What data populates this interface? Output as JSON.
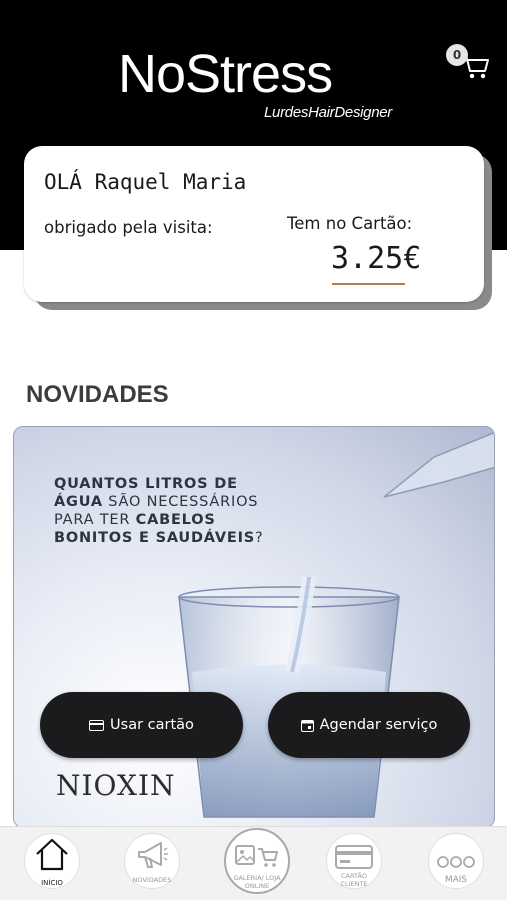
{
  "header": {
    "logo_main": "NoStress",
    "logo_sub": "LurdesHairDesigner",
    "cart_count": "0",
    "cart_icon": "shopping-cart-icon"
  },
  "card": {
    "greeting": "OLÁ Raquel Maria",
    "thanks": "obrigado pela visita:",
    "label": "Tem no Cartão:",
    "amount": "3.25€"
  },
  "news": {
    "title": "NOVIDADES",
    "promo_lines": [
      [
        "QUANTOS LITROS DE"
      ],
      [
        "ÁGUA",
        " SÃO NECESSÁRIOS"
      ],
      [
        "PARA TER ",
        "CABELOS"
      ],
      [
        "BONITOS E SAUDÁVEIS",
        "?"
      ]
    ],
    "brand": "NIOXIN"
  },
  "actions": {
    "use_card": "Usar cartão",
    "book_service": "Agendar serviço"
  },
  "nav": {
    "home": "INÍCIO",
    "news": "NOVIDADES",
    "gallery": "GALERIA/ LOJA ONLINE",
    "card": "CARTÃO CLIENTE",
    "more": "MAIS"
  },
  "colors": {
    "header_bg": "#000000",
    "accent_underline": "#b87a4b",
    "button_bg": "#1b1b1d"
  }
}
